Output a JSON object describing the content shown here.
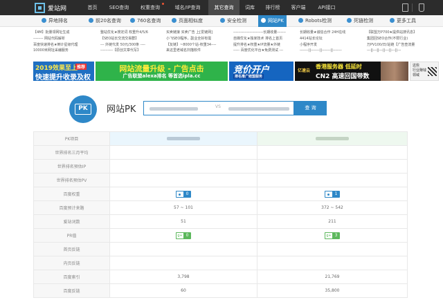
{
  "brand": {
    "name": "爱站网"
  },
  "topnav": [
    {
      "label": "首页",
      "active": false,
      "dot": false
    },
    {
      "label": "SEO查询",
      "active": false,
      "dot": false
    },
    {
      "label": "权重查询",
      "active": false,
      "dot": true
    },
    {
      "label": "域名/IP查询",
      "active": false,
      "dot": false
    },
    {
      "label": "其它查询",
      "active": true,
      "dot": false
    },
    {
      "label": "词库",
      "active": false,
      "dot": false
    },
    {
      "label": "排行榜",
      "active": false,
      "dot": false
    },
    {
      "label": "客户端",
      "active": false,
      "dot": false
    },
    {
      "label": "API接口",
      "active": false,
      "dot": false
    }
  ],
  "subnav": [
    {
      "label": "异地排名",
      "icon": "location-icon",
      "active": false
    },
    {
      "label": "前20名查询",
      "icon": "list-icon",
      "active": false
    },
    {
      "label": "760名查询",
      "icon": "rank-icon",
      "active": false
    },
    {
      "label": "页面相似度",
      "icon": "page-icon",
      "active": false
    },
    {
      "label": "安全检测",
      "icon": "shield-icon",
      "active": false
    },
    {
      "label": "网站PK",
      "icon": "pk-icon",
      "active": true
    },
    {
      "label": "Robots检测",
      "icon": "robot-icon",
      "active": false
    },
    {
      "label": "死链检测",
      "icon": "link-icon",
      "active": false
    },
    {
      "label": "更多工具",
      "icon": "more-icon",
      "active": false
    }
  ],
  "adlinks": [
    [
      "【4M】批量领网址生成",
      "-------- 网站代码解析",
      "百度快速排名★倒计星级代理",
      "10000米网址采编服务"
    ],
    [
      "整站优化★搜定词 权重升4/5/6",
      "【SEO站长交流交易群】",
      "--- 外链代发 50元/300条 ----",
      "----------【原创文章代写】"
    ],
    [
      "买卖链接 买卖广告 上[爱链网]",
      "小飞SEO程序，副业全好有需",
      "【友链】~8000个站-权重34----",
      "来这里老域名扫描软件"
    ],
    [
      "------------------------长期收量-------",
      "自媒优化★独家技术 排名上首页",
      "提升排名★权重★IP流量★外链",
      "----- 百度优化平台★免费测试 ---"
    ],
    [
      "长期收量★诚信合作 24H在线",
      "4414站长论坛",
      "小程序开发",
      "-------||-------||-------||-------"
    ],
    [
      "【联盟万P700★提供站搜讯息】",
      "集团回SEO合作(不限行业)",
      "万PV100/日/站链【广告查流量",
      "---||---||---||---||---||---"
    ]
  ],
  "banners": {
    "b1": {
      "line1": "2019效果至上",
      "tag": "推荐",
      "line2": "快速提升收录及权重"
    },
    "b2": {
      "line1": "网站流量升级 - 广告点击",
      "line2": "广告联盟alexa排名 等首选ipla.cc"
    },
    "b3": {
      "line1": "竞价开户",
      "line2": "排名推广结盟服务"
    },
    "b4": {
      "brand": "亿速云",
      "line1": "香港服务器 低延时",
      "line2": "CN2 高速回国带数"
    },
    "b5": {
      "line1": "这些\n行业赚钱\n领域"
    }
  },
  "pk": {
    "title": "网站PK",
    "vs": "VS",
    "button": "查 询"
  },
  "table": {
    "header_label": "PK项目",
    "rows": [
      {
        "label": "世界排名三月平均",
        "left": "",
        "right": ""
      },
      {
        "label": "世界排名预估IP",
        "left": "",
        "right": ""
      },
      {
        "label": "世界排名预估PV",
        "left": "",
        "right": ""
      },
      {
        "label": "百度权重",
        "badge": "br",
        "left": "0",
        "right": "1"
      },
      {
        "label": "百度预计来路",
        "left": "57 ~ 101",
        "right": "372 ~ 542"
      },
      {
        "label": "爱站词数",
        "left": "51",
        "right": "211"
      },
      {
        "label": "PR值",
        "badge": "pr",
        "left": "0",
        "right": "3"
      },
      {
        "label": "首页反链",
        "left": "",
        "right": ""
      },
      {
        "label": "内页反链",
        "left": "",
        "right": ""
      },
      {
        "label": "百度索引",
        "left": "3,798",
        "right": "21,769"
      },
      {
        "label": "百度反链",
        "left": "60",
        "right": "35,800"
      }
    ]
  }
}
